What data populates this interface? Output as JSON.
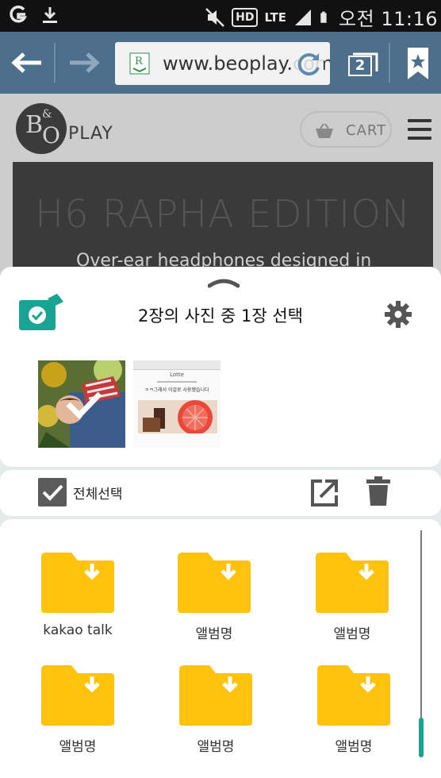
{
  "status_bar": {
    "carrier_icon": "carrier-g-icon",
    "download_icon": "download-icon",
    "hd_label": "HD",
    "lte_label": "LTE",
    "time": "오전 11:16"
  },
  "browser": {
    "url": "www.beoplay.com",
    "tab_count": "2"
  },
  "webpage": {
    "brand_play": "PLAY",
    "cart_label": "CART",
    "hero_title": "H6 RAPHA EDITION",
    "hero_subtitle": "Over-ear headphones designed in"
  },
  "sheet": {
    "title": "2장의 사진 중 1장 선택",
    "select_all_label": "전체선택",
    "thumb_caption": "ㅇㅋ그래서 이걸로 사용했습니다",
    "thumb_header": "Lotte",
    "folders": [
      {
        "label": "kakao talk"
      },
      {
        "label": "앨범명"
      },
      {
        "label": "앨범명"
      },
      {
        "label": "앨범명"
      },
      {
        "label": "앨범명"
      },
      {
        "label": "앨범명"
      }
    ]
  },
  "colors": {
    "accent": "#1aa392",
    "folder": "#ffc20e",
    "browser_bar": "#4d6f8c"
  }
}
